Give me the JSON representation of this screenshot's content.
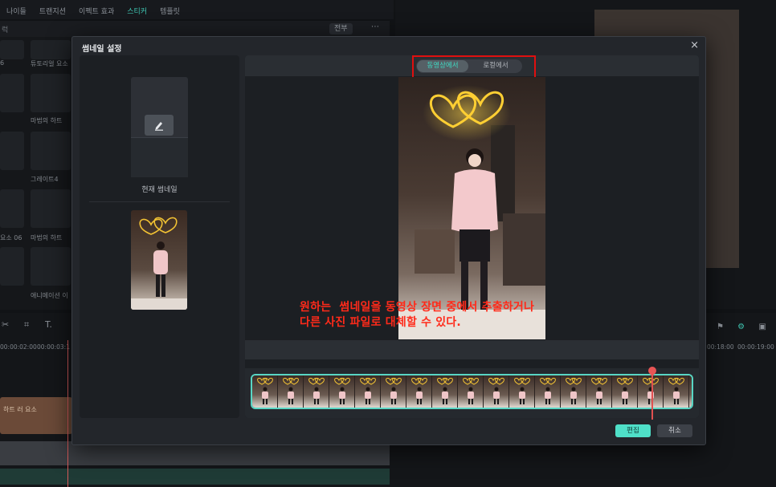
{
  "background": {
    "top_tabs": [
      "나이들",
      "트랜지션",
      "이펙트 효과",
      "스티커",
      "템플릿"
    ],
    "active_top_tab": "스티커",
    "filter_left": "럭",
    "filter_select": "전부",
    "more_icon": "⋯",
    "asset_labels": [
      "튜토리얼 요소",
      "마법의 하트",
      "그레이트4",
      "마법의 하트",
      "요소 06",
      "애니메이션 이"
    ],
    "asset_label_left": [
      "6",
      "",
      "",
      ""
    ],
    "ruler_times": [
      "00:00:02:00",
      "00:00:03:1",
      "00:18:00",
      "00:00:19:00"
    ],
    "track_label": "하트 러 요소",
    "tool_icons": [
      "✂",
      "⌗",
      "T."
    ]
  },
  "modal": {
    "title": "썸네일 설정",
    "close_icon": "×",
    "current_thumbnail_label": "현재 썸네일",
    "tabs": [
      {
        "label": "동영상에서",
        "active": true
      },
      {
        "label": "로컬에서",
        "active": false
      }
    ],
    "edit_button": "편집",
    "cancel_button": "취소"
  },
  "annotation": {
    "line1": "원하는  썸네일을 동영상 장면 중에서 추출하거나",
    "line2": "다른 사진 파일로 대체할 수 있다."
  },
  "colors": {
    "accent": "#3fd9c3",
    "highlight_box": "#e00f0f",
    "annotation_text": "#ff2a1a"
  }
}
